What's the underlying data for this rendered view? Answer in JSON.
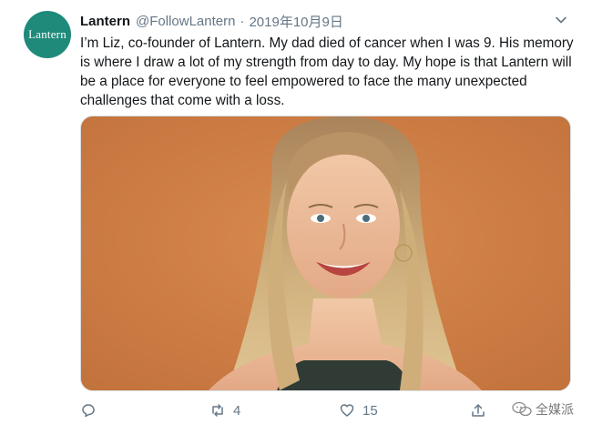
{
  "tweet": {
    "avatar_text": "Lantern",
    "author_name": "Lantern",
    "handle": "@FollowLantern",
    "separator": "·",
    "date": "2019年10月9日",
    "text": "I’m Liz, co-founder of Lantern. My dad died of cancer when I was 9. His memory is where I draw a lot of my strength from day to day. My hope is that Lantern will be a place for everyone to feel empowered to face the many unexpected challenges that come with a loss.",
    "photo_icon": "portrait-photo",
    "actions": {
      "reply_icon": "reply-icon",
      "retweet_icon": "retweet-icon",
      "retweet_count": "4",
      "like_icon": "heart-icon",
      "like_count": "15",
      "share_icon": "share-icon"
    }
  },
  "watermark": {
    "text": "全媒派"
  },
  "colors": {
    "accent": "#1f8a7a",
    "muted": "#657786",
    "photo_bg": "#cf7e44"
  }
}
